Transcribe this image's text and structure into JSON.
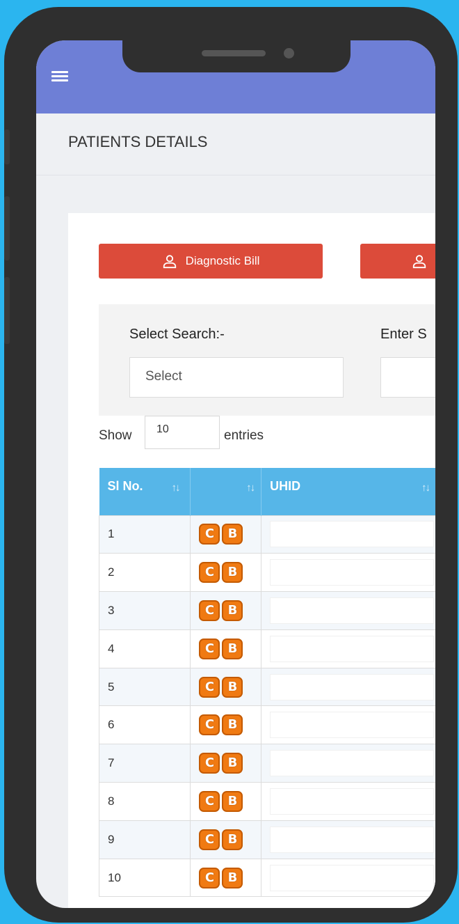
{
  "page": {
    "title": "PATIENTS DETAILS"
  },
  "header": {
    "menu_icon": "hamburger-menu-icon"
  },
  "actions": [
    {
      "label": "Diagnostic Bill",
      "icon": "user-icon"
    },
    {
      "label": "",
      "icon": "user-icon"
    }
  ],
  "search": {
    "select_label": "Select Search:-",
    "select_placeholder": "Select",
    "enter_label": "Enter S",
    "enter_value": ""
  },
  "length": {
    "show_label": "Show",
    "value": "10",
    "entries_label": "entries"
  },
  "table": {
    "columns": [
      "Sl No.",
      "",
      "UHID"
    ],
    "sort_glyph": "↑↓",
    "badges": {
      "c": "C",
      "b": "B"
    },
    "rows": [
      "1",
      "2",
      "3",
      "4",
      "5",
      "6",
      "7",
      "8",
      "9",
      "10"
    ]
  },
  "colors": {
    "topbar": "#6e7fd6",
    "button": "#dc4b3a",
    "table_header": "#56b6e8",
    "badge": "#f07a12",
    "background": "#2bb5ef"
  }
}
